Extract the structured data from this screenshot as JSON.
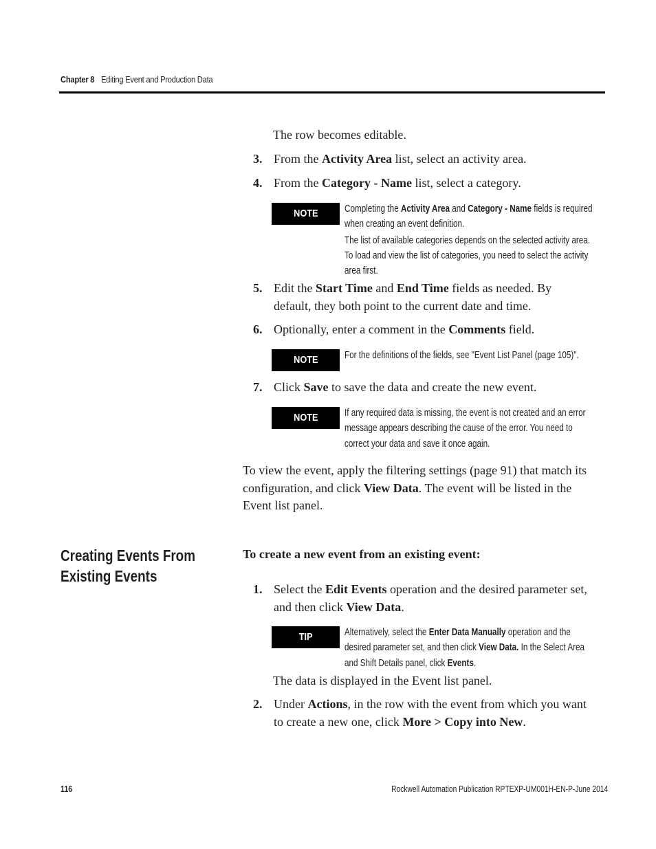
{
  "header": {
    "chapter": "Chapter 8",
    "chapter_title": "Editing Event and Production Data"
  },
  "content": {
    "row_editable": "The row becomes editable.",
    "steps_a": [
      {
        "num": "3.",
        "pre": "From the ",
        "bold": "Activity Area",
        "post": " list, select an activity area."
      },
      {
        "num": "4.",
        "pre": "From the ",
        "bold": "Category - Name",
        "post": " list, select a category."
      }
    ],
    "note1": {
      "badge": "NOTE",
      "p1_pre": "Completing the ",
      "p1_b1": "Activity Area",
      "p1_mid": " and ",
      "p1_b2": "Category - Name",
      "p1_post": " fields is required when creating an event definition.",
      "p2": "The list of available categories depends on the selected activity area. To load and view the list of categories, you need to select the activity area first."
    },
    "step5": {
      "num": "5.",
      "pre": "Edit the ",
      "b1": "Start Time",
      "mid": " and ",
      "b2": "End Time",
      "post": " fields as needed. By default, they both point to the current date and time."
    },
    "step6": {
      "num": "6.",
      "pre": "Optionally, enter a comment in the ",
      "bold": "Comments",
      "post": " field."
    },
    "note2": {
      "badge": "NOTE",
      "text": "For the definitions of the fields, see \"Event List Panel (page 105)\"."
    },
    "step7": {
      "num": "7.",
      "pre": "Click ",
      "bold": "Save",
      "post": " to save the data and create the new event."
    },
    "note3": {
      "badge": "NOTE",
      "text": "If any required data is missing, the event is not created and an error message appears describing the cause of the error. You need to correct your data and save it once again."
    },
    "view_para": {
      "pre": "To view the event, apply the filtering settings (page 91) that match its configuration, and click ",
      "bold": "View Data",
      "post": ". The event will be listed in the Event list panel."
    }
  },
  "section": {
    "title_line1": "Creating Events From",
    "title_line2": "Existing Events",
    "procedure_title": "To create a new event from an existing event:",
    "step1": {
      "num": "1.",
      "pre": "Select the ",
      "b1": "Edit Events",
      "mid": " operation and the desired parameter set, and then click ",
      "b2": "View Data",
      "post": "."
    },
    "tip": {
      "badge": "TIP",
      "pre": "Alternatively, select the ",
      "b1": "Enter Data Manually",
      "mid1": " operation and the desired parameter set, and then click ",
      "b2": "View Data.",
      "mid2": " In the Select Area and Shift Details panel, click ",
      "b3": "Events",
      "post": "."
    },
    "displayed": "The data is displayed in the Event list panel.",
    "step2": {
      "num": "2.",
      "pre": "Under ",
      "b1": "Actions",
      "mid": ", in the row with the event from which you want to create a new one, click ",
      "b2": "More > Copy into New",
      "post": "."
    }
  },
  "footer": {
    "page_number": "116",
    "publication": "Rockwell Automation Publication RPTEXP-UM001H-EN-P-June 2014"
  }
}
